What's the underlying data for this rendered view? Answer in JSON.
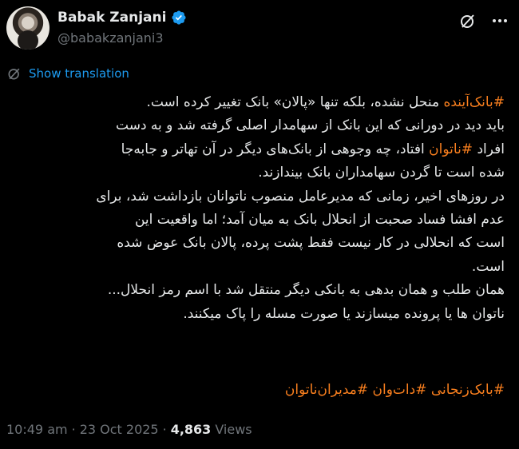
{
  "author": {
    "name": "Babak Zanjani",
    "handle": "@babakzanjani3",
    "verified": true
  },
  "translate_label": "Show translation",
  "tweet": {
    "lines": [
      {
        "tag": "#بانک‌آینده",
        "text": " منحل نشده، بلکه تنها «پالان» بانک تغییر کرده است."
      },
      {
        "text": "باید دید در دورانی که این بانک از سهامدار اصلی گرفته شد و به دست"
      },
      {
        "pre": "افراد ",
        "tag": "#ناتوان",
        "text": " افتاد، چه وجوهی از بانک‌های دیگر در آن تهاتر و جابه‌جا"
      },
      {
        "text": "شده است تا گردن سهامداران بانک بیندازند."
      },
      {
        "text": "در روزهای اخیر، زمانی که مدیرعامل منصوب ناتوانان بازداشت شد، برای"
      },
      {
        "text": "عدم افشا فساد صحبت از انحلال بانک به میان آمد؛ اما واقعیت این"
      },
      {
        "text": "است که انحلالی در کار نیست فقط پشت پرده، پالان بانک عوض شده"
      },
      {
        "text": "است."
      },
      {
        "text": "همان طلب و همان بدهی به بانکی دیگر منتقل شد  با اسم رمز انحلال..."
      },
      {
        "text": "ناتوان ها یا پرونده میسازند یا صورت مسله را پاک میکنند."
      }
    ],
    "hashtags": [
      "#بابک‌زنجانی",
      "#دات‌وان",
      "#مدیران‌ناتوان"
    ]
  },
  "meta": {
    "time": "10:49 am",
    "date": "23 Oct 2025",
    "views_count": "4,863",
    "views_label": "Views"
  },
  "colors": {
    "background": "#000000",
    "text": "#e7e9ea",
    "muted": "#71767b",
    "link": "#1d9bf0",
    "hashtag": "#f97f1e"
  },
  "icons": [
    "verified-badge-icon",
    "grok-icon",
    "more-options-icon",
    "translate-icon"
  ]
}
